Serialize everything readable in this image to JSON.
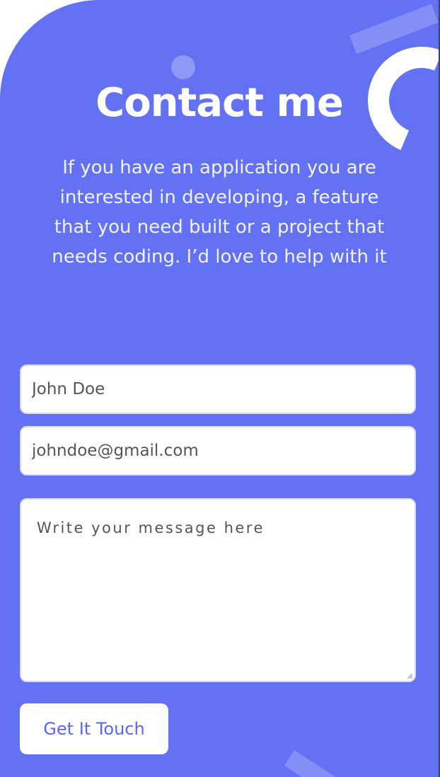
{
  "header": {
    "title": "Contact me",
    "intro": "If you have an application you are interested in developing, a feature that you need built or a project that needs coding. I’d love to help with it"
  },
  "form": {
    "name_placeholder": "John Doe",
    "email_placeholder": "johndoe@gmail.com",
    "message_placeholder": "Write your message here",
    "submit_label": "Get It Touch"
  },
  "colors": {
    "background": "#6371f4",
    "accent_text": "#5a67ef",
    "field_background": "#ffffff"
  }
}
